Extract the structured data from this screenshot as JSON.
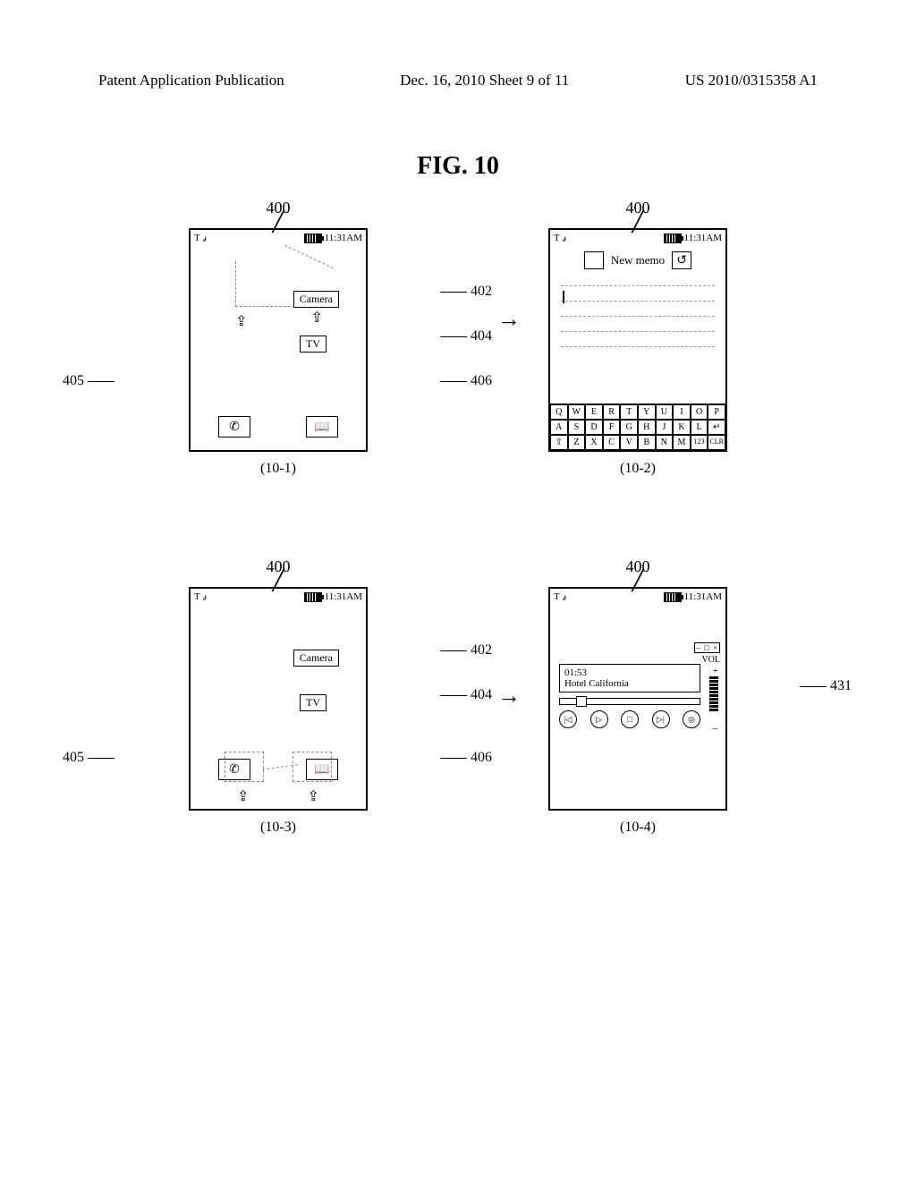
{
  "header": {
    "left": "Patent Application Publication",
    "center": "Dec. 16, 2010  Sheet 9 of 11",
    "right": "US 2010/0315358 A1"
  },
  "figure_title": "FIG. 10",
  "refs": {
    "r400": "400",
    "r402": "402",
    "r404": "404",
    "r405": "405",
    "r406": "406",
    "r431": "431"
  },
  "sublabels": {
    "s1": "(10-1)",
    "s2": "(10-2)",
    "s3": "(10-3)",
    "s4": "(10-4)"
  },
  "status": {
    "signal": "▮▯▮▯▮",
    "time": "11:31AM",
    "antenna": "T ₐᵢₗ"
  },
  "home": {
    "camera": "Camera",
    "tv": "TV"
  },
  "memo": {
    "title": "New memo"
  },
  "keyboard": {
    "row1": [
      "Q",
      "W",
      "E",
      "R",
      "T",
      "Y",
      "U",
      "I",
      "O",
      "P"
    ],
    "row2": [
      "A",
      "S",
      "D",
      "F",
      "G",
      "H",
      "J",
      "K",
      "L",
      "↵"
    ],
    "row3": [
      "⇧",
      "Z",
      "X",
      "C",
      "V",
      "B",
      "N",
      "M",
      "123",
      "CLR"
    ]
  },
  "player": {
    "win_ctrls": "– □ ×",
    "vol": "VOL",
    "plus": "+",
    "minus": "–",
    "time": "01:53",
    "track": "Hotel California",
    "btn_prev": "|◁",
    "btn_play": "▷",
    "btn_stop": "□",
    "btn_next": "▷|",
    "btn_eq": "◎"
  }
}
